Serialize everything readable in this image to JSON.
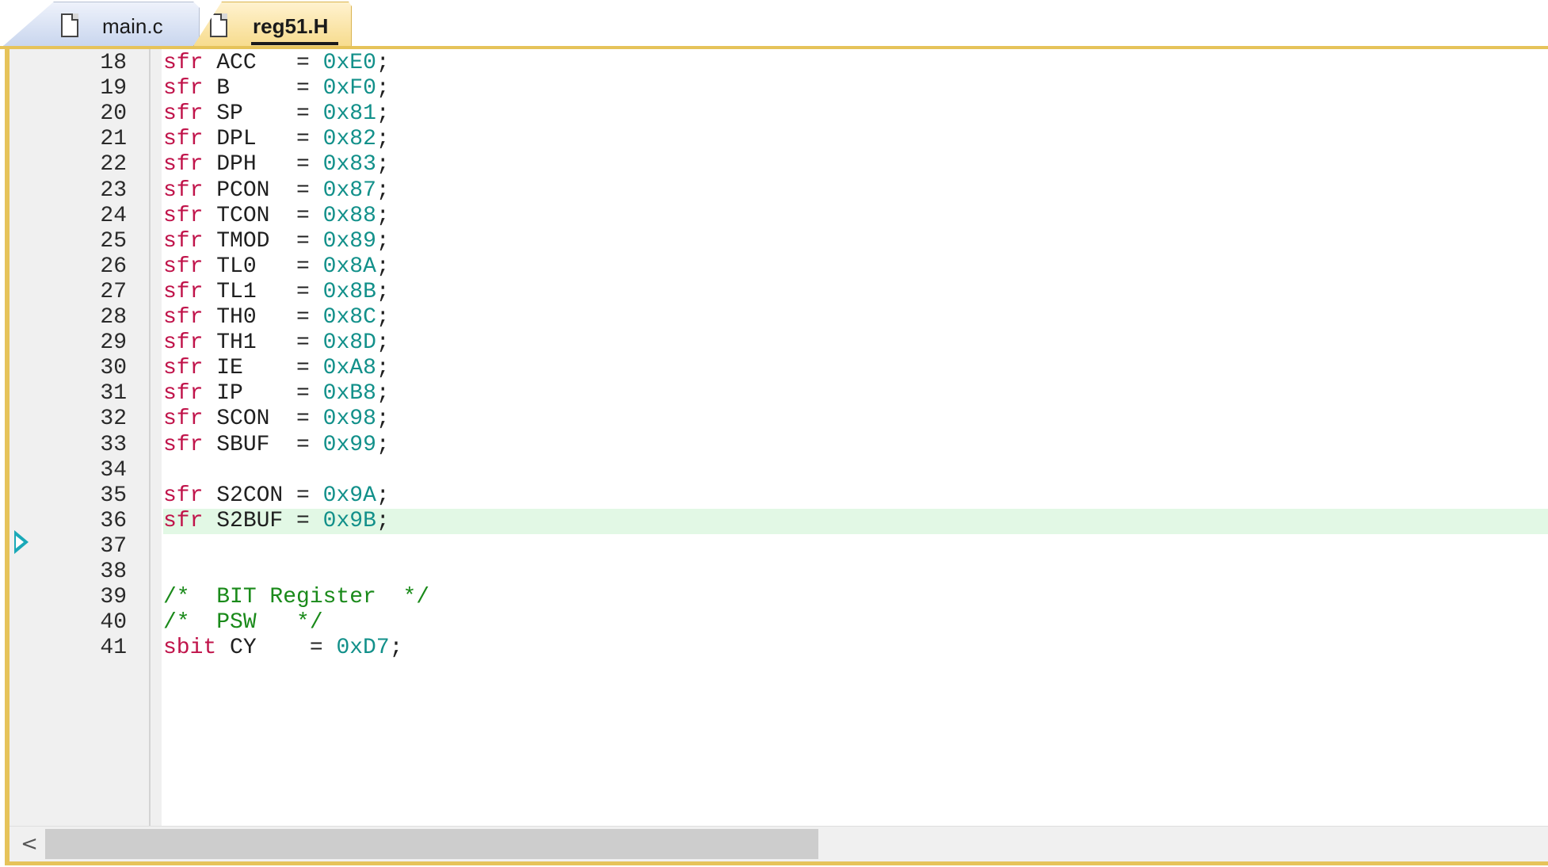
{
  "tabs": [
    {
      "label": "main.c",
      "icon": "file-icon",
      "active": false
    },
    {
      "label": "reg51.H",
      "icon": "file-icon",
      "active": true
    }
  ],
  "colors": {
    "keyword": "#c0134a",
    "number": "#12908a",
    "comment": "#1a8a1a",
    "current_line_highlight": "#e2f8e5",
    "active_tab_accent": "#e6c35a",
    "execution_marker": "#1aa9b8"
  },
  "editor": {
    "execution_marker_line": 33,
    "highlighted_line": 36,
    "lines": [
      {
        "n": "18",
        "tokens": [
          {
            "t": "kw",
            "v": "sfr"
          },
          {
            "t": "tx",
            "v": " ACC   = "
          },
          {
            "t": "num",
            "v": "0xE0"
          },
          {
            "t": "tx",
            "v": ";"
          }
        ]
      },
      {
        "n": "19",
        "tokens": [
          {
            "t": "kw",
            "v": "sfr"
          },
          {
            "t": "tx",
            "v": " B     = "
          },
          {
            "t": "num",
            "v": "0xF0"
          },
          {
            "t": "tx",
            "v": ";"
          }
        ]
      },
      {
        "n": "20",
        "tokens": [
          {
            "t": "kw",
            "v": "sfr"
          },
          {
            "t": "tx",
            "v": " SP    = "
          },
          {
            "t": "num",
            "v": "0x81"
          },
          {
            "t": "tx",
            "v": ";"
          }
        ]
      },
      {
        "n": "21",
        "tokens": [
          {
            "t": "kw",
            "v": "sfr"
          },
          {
            "t": "tx",
            "v": " DPL   = "
          },
          {
            "t": "num",
            "v": "0x82"
          },
          {
            "t": "tx",
            "v": ";"
          }
        ]
      },
      {
        "n": "22",
        "tokens": [
          {
            "t": "kw",
            "v": "sfr"
          },
          {
            "t": "tx",
            "v": " DPH   = "
          },
          {
            "t": "num",
            "v": "0x83"
          },
          {
            "t": "tx",
            "v": ";"
          }
        ]
      },
      {
        "n": "23",
        "tokens": [
          {
            "t": "kw",
            "v": "sfr"
          },
          {
            "t": "tx",
            "v": " PCON  = "
          },
          {
            "t": "num",
            "v": "0x87"
          },
          {
            "t": "tx",
            "v": ";"
          }
        ]
      },
      {
        "n": "24",
        "tokens": [
          {
            "t": "kw",
            "v": "sfr"
          },
          {
            "t": "tx",
            "v": " TCON  = "
          },
          {
            "t": "num",
            "v": "0x88"
          },
          {
            "t": "tx",
            "v": ";"
          }
        ]
      },
      {
        "n": "25",
        "tokens": [
          {
            "t": "kw",
            "v": "sfr"
          },
          {
            "t": "tx",
            "v": " TMOD  = "
          },
          {
            "t": "num",
            "v": "0x89"
          },
          {
            "t": "tx",
            "v": ";"
          }
        ]
      },
      {
        "n": "26",
        "tokens": [
          {
            "t": "kw",
            "v": "sfr"
          },
          {
            "t": "tx",
            "v": " TL0   = "
          },
          {
            "t": "num",
            "v": "0x8A"
          },
          {
            "t": "tx",
            "v": ";"
          }
        ]
      },
      {
        "n": "27",
        "tokens": [
          {
            "t": "kw",
            "v": "sfr"
          },
          {
            "t": "tx",
            "v": " TL1   = "
          },
          {
            "t": "num",
            "v": "0x8B"
          },
          {
            "t": "tx",
            "v": ";"
          }
        ]
      },
      {
        "n": "28",
        "tokens": [
          {
            "t": "kw",
            "v": "sfr"
          },
          {
            "t": "tx",
            "v": " TH0   = "
          },
          {
            "t": "num",
            "v": "0x8C"
          },
          {
            "t": "tx",
            "v": ";"
          }
        ]
      },
      {
        "n": "29",
        "tokens": [
          {
            "t": "kw",
            "v": "sfr"
          },
          {
            "t": "tx",
            "v": " TH1   = "
          },
          {
            "t": "num",
            "v": "0x8D"
          },
          {
            "t": "tx",
            "v": ";"
          }
        ]
      },
      {
        "n": "30",
        "tokens": [
          {
            "t": "kw",
            "v": "sfr"
          },
          {
            "t": "tx",
            "v": " IE    = "
          },
          {
            "t": "num",
            "v": "0xA8"
          },
          {
            "t": "tx",
            "v": ";"
          }
        ]
      },
      {
        "n": "31",
        "tokens": [
          {
            "t": "kw",
            "v": "sfr"
          },
          {
            "t": "tx",
            "v": " IP    = "
          },
          {
            "t": "num",
            "v": "0xB8"
          },
          {
            "t": "tx",
            "v": ";"
          }
        ]
      },
      {
        "n": "32",
        "tokens": [
          {
            "t": "kw",
            "v": "sfr"
          },
          {
            "t": "tx",
            "v": " SCON  = "
          },
          {
            "t": "num",
            "v": "0x98"
          },
          {
            "t": "tx",
            "v": ";"
          }
        ]
      },
      {
        "n": "33",
        "tokens": [
          {
            "t": "kw",
            "v": "sfr"
          },
          {
            "t": "tx",
            "v": " SBUF  = "
          },
          {
            "t": "num",
            "v": "0x99"
          },
          {
            "t": "tx",
            "v": ";"
          }
        ]
      },
      {
        "n": "34",
        "tokens": []
      },
      {
        "n": "35",
        "tokens": [
          {
            "t": "kw",
            "v": "sfr"
          },
          {
            "t": "tx",
            "v": " S2CON = "
          },
          {
            "t": "num",
            "v": "0x9A"
          },
          {
            "t": "tx",
            "v": ";"
          }
        ]
      },
      {
        "n": "36",
        "tokens": [
          {
            "t": "kw",
            "v": "sfr"
          },
          {
            "t": "tx",
            "v": " S2BUF = "
          },
          {
            "t": "num",
            "v": "0x9B"
          },
          {
            "t": "tx",
            "v": ";"
          }
        ]
      },
      {
        "n": "37",
        "tokens": []
      },
      {
        "n": "38",
        "tokens": []
      },
      {
        "n": "39",
        "tokens": [
          {
            "t": "cm",
            "v": "/*  BIT Register  */"
          }
        ]
      },
      {
        "n": "40",
        "tokens": [
          {
            "t": "cm",
            "v": "/*  PSW   */"
          }
        ]
      },
      {
        "n": "41",
        "tokens": [
          {
            "t": "kw",
            "v": "sbit"
          },
          {
            "t": "tx",
            "v": " CY    = "
          },
          {
            "t": "num",
            "v": "0xD7"
          },
          {
            "t": "tx",
            "v": ";"
          }
        ]
      }
    ]
  },
  "scrollbar": {
    "left_arrow": "<",
    "left_arrow_icon": "chevron-left-icon",
    "thumb_fraction": 0.52
  }
}
